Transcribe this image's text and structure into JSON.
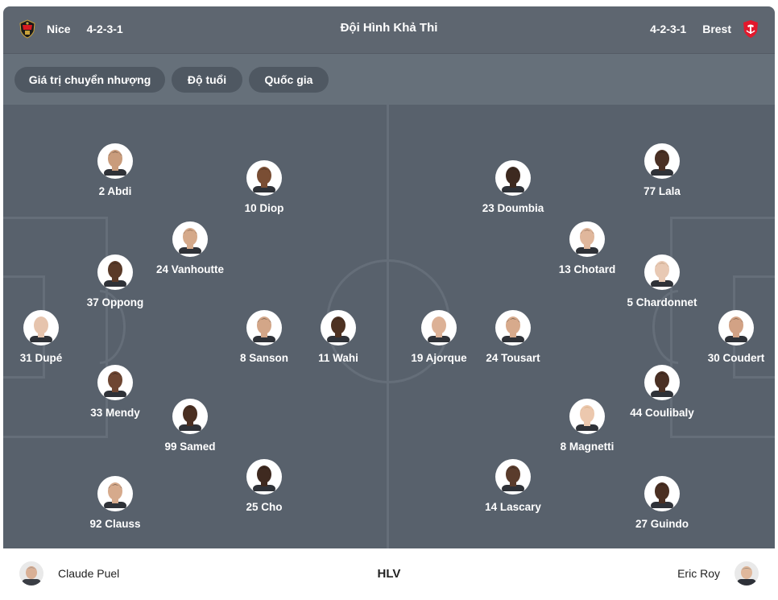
{
  "header": {
    "home_team": "Nice",
    "home_formation": "4-2-3-1",
    "title": "Đội Hình Khả Thi",
    "away_formation": "4-2-3-1",
    "away_team": "Brest",
    "home_crest_icon": "nice-crest-icon",
    "away_crest_icon": "brest-crest-icon"
  },
  "filters": [
    "Giá trị chuyển nhượng",
    "Độ tuổi",
    "Quốc gia"
  ],
  "home_players": [
    {
      "label": "2 Abdi",
      "skin": "#c99c7c",
      "hair": "#2a1d16"
    },
    {
      "label": "10 Diop",
      "skin": "#7a4e34",
      "hair": "#1c1410"
    },
    {
      "label": "24 Vanhoutte",
      "skin": "#d5a98a",
      "hair": "#4a3322"
    },
    {
      "label": "37 Oppong",
      "skin": "#5a3a28",
      "hair": "#141010"
    },
    {
      "label": "31 Dupé",
      "skin": "#e6c4ad",
      "hair": "#e6c4ad"
    },
    {
      "label": "8 Sanson",
      "skin": "#d3a688",
      "hair": "#2e241d"
    },
    {
      "label": "11 Wahi",
      "skin": "#4e3222",
      "hair": "#161010"
    },
    {
      "label": "33 Mendy",
      "skin": "#6e4632",
      "hair": "#181210"
    },
    {
      "label": "99 Samed",
      "skin": "#4a2f22",
      "hair": "#161010"
    },
    {
      "label": "25 Cho",
      "skin": "#3f2a20",
      "hair": "#131010"
    },
    {
      "label": "92 Clauss",
      "skin": "#d6aa8c",
      "hair": "#2e241d"
    }
  ],
  "away_players": [
    {
      "label": "23 Doumbia",
      "skin": "#3e2a20",
      "hair": "#141010"
    },
    {
      "label": "77 Lala",
      "skin": "#4a3024",
      "hair": "#141010"
    },
    {
      "label": "13 Chotard",
      "skin": "#e0b79c",
      "hair": "#5a3a26"
    },
    {
      "label": "5 Chardonnet",
      "skin": "#e8c9b4",
      "hair": "#a07a56"
    },
    {
      "label": "19 Ajorque",
      "skin": "#dcb196",
      "hair": "#dcb196"
    },
    {
      "label": "24 Tousart",
      "skin": "#d7aa8c",
      "hair": "#2e241d"
    },
    {
      "label": "30 Coudert",
      "skin": "#d2a285",
      "hair": "#3a2a1f"
    },
    {
      "label": "44 Coulibaly",
      "skin": "#4a3024",
      "hair": "#141010"
    },
    {
      "label": "8 Magnetti",
      "skin": "#ecc8ae",
      "hair": "#c49a62"
    },
    {
      "label": "14 Lascary",
      "skin": "#5a3c2c",
      "hair": "#141010"
    },
    {
      "label": "27 Guindo",
      "skin": "#4a2f22",
      "hair": "#1a1411"
    }
  ],
  "coaches": {
    "home_name": "Claude Puel",
    "label": "HLV",
    "away_name": "Eric Roy"
  },
  "colors": {
    "header_bg": "#5e6670",
    "filter_bar_bg": "#66707a",
    "chip_bg": "#4f5862",
    "pitch_bg": "#58616c",
    "pitch_lines": "#656e79",
    "nice_red": "#d71920",
    "brest_red": "#e2182c"
  }
}
